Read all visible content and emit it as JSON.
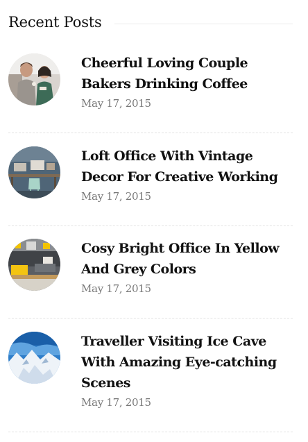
{
  "widget": {
    "title": "Recent Posts"
  },
  "posts": [
    {
      "title_line1": "Cheerful Loving Couple",
      "title_line2": "Bakers Drinking Coffee",
      "title_line3": "",
      "date": "May 17, 2015",
      "thumbnail": "couple-bakers-thumbnail"
    },
    {
      "title_line1": "Loft Office With Vintage",
      "title_line2": "Decor For Creative Working",
      "title_line3": "",
      "date": "May 17, 2015",
      "thumbnail": "loft-office-thumbnail"
    },
    {
      "title_line1": "Cosy Bright Office In Yellow",
      "title_line2": "And Grey Colors",
      "title_line3": "",
      "date": "May 17, 2015",
      "thumbnail": "yellow-grey-office-thumbnail"
    },
    {
      "title_line1": "Traveller Visiting Ice Cave",
      "title_line2": "With Amazing Eye-catching",
      "title_line3": "Scenes",
      "date": "May 17, 2015",
      "thumbnail": "ice-cave-thumbnail"
    }
  ],
  "colors": {
    "title_text": "#111111",
    "date_text": "#777777",
    "divider": "#e2e2e2"
  }
}
